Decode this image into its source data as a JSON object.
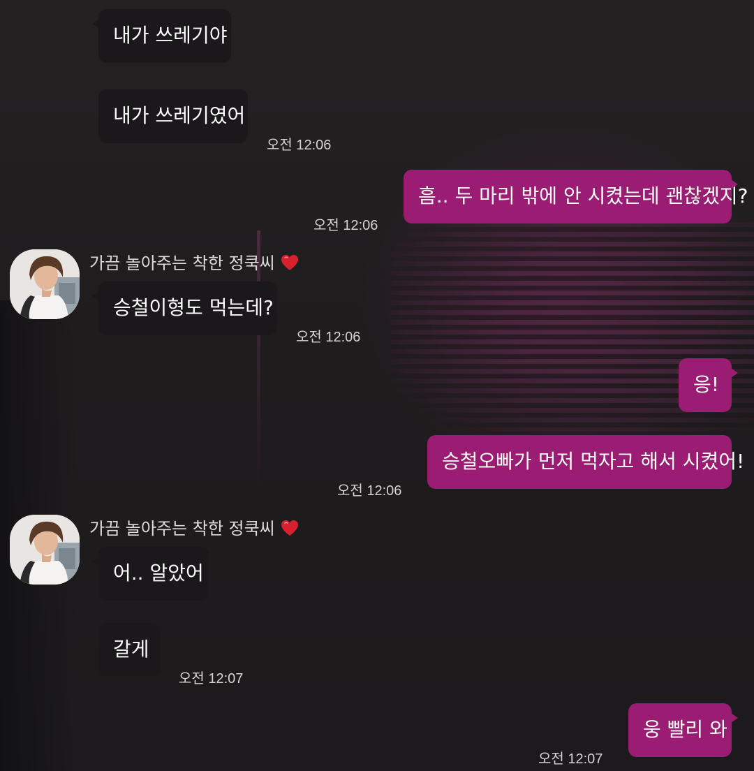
{
  "messages": [
    {
      "text": "내가 쓰레기야",
      "dir": "in"
    },
    {
      "text": "내가 쓰레기였어",
      "dir": "in",
      "time": "오전 12:06"
    },
    {
      "text": "흠.. 두 마리 밖에 안 시켰는데 괜찮겠지?",
      "dir": "out",
      "time": "오전 12:06"
    },
    {
      "sender": "가끔 놀아주는 착한 정쿡씨",
      "text": "승철이형도 먹는데?",
      "dir": "in",
      "time": "오전 12:06"
    },
    {
      "text": "응!",
      "dir": "out"
    },
    {
      "text": "승철오빠가 먼저 먹자고 해서 시켰어!",
      "dir": "out",
      "time": "오전 12:06"
    },
    {
      "sender": "가끔 놀아주는 착한 정쿡씨",
      "text": "어.. 알았어",
      "dir": "in"
    },
    {
      "text": "갈게",
      "dir": "in",
      "time": "오전 12:07"
    },
    {
      "text": "웅 빨리 와",
      "dir": "out",
      "time": "오전 12:07"
    }
  ],
  "colors": {
    "outgoing_bubble": "#9b1d73",
    "incoming_bubble": "#1a181a",
    "heart": "#d8212f"
  },
  "icons": {
    "sender_badge": "red-heart-icon"
  }
}
